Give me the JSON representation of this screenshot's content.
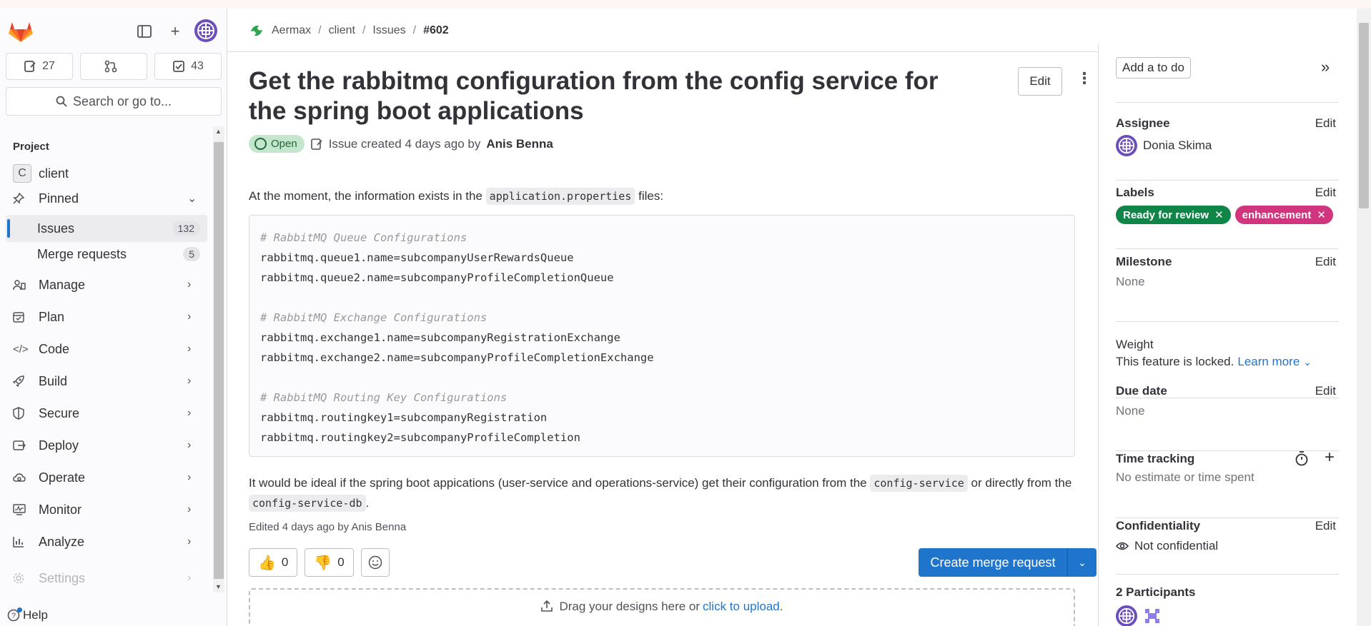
{
  "sidebar": {
    "counts": {
      "issues": "27",
      "merge_requests": "",
      "todos": "43"
    },
    "search_label": "Search or go to...",
    "section_title": "Project",
    "project": {
      "initial": "C",
      "name": "client"
    },
    "pinned_label": "Pinned",
    "pinned_items": [
      {
        "label": "Issues",
        "count": "132"
      },
      {
        "label": "Merge requests",
        "count": "5"
      }
    ],
    "nav": [
      "Manage",
      "Plan",
      "Code",
      "Build",
      "Secure",
      "Deploy",
      "Operate",
      "Monitor",
      "Analyze",
      "Settings"
    ],
    "help_label": "Help"
  },
  "breadcrumb": [
    "Aermax",
    "client",
    "Issues",
    "#602"
  ],
  "issue": {
    "title": "Get the rabbitmq configuration from the config service for the spring boot applications",
    "edit_label": "Edit",
    "status": "Open",
    "meta_prefix": "Issue created 4 days ago by",
    "author": "Anis Benna",
    "para1_before": "At the moment, the information exists in the",
    "para1_code": "application.properties",
    "para1_after": "files:",
    "code_lines": [
      {
        "text": "# RabbitMQ Queue Configurations",
        "comment": true
      },
      {
        "text": "rabbitmq.queue1.name=subcompanyUserRewardsQueue",
        "comment": false
      },
      {
        "text": "rabbitmq.queue2.name=subcompanyProfileCompletionQueue",
        "comment": false
      },
      {
        "text": "",
        "comment": false
      },
      {
        "text": "# RabbitMQ Exchange Configurations",
        "comment": true
      },
      {
        "text": "rabbitmq.exchange1.name=subcompanyRegistrationExchange",
        "comment": false
      },
      {
        "text": "rabbitmq.exchange2.name=subcompanyProfileCompletionExchange",
        "comment": false
      },
      {
        "text": "",
        "comment": false
      },
      {
        "text": "# RabbitMQ Routing Key Configurations",
        "comment": true
      },
      {
        "text": "rabbitmq.routingkey1=subcompanyRegistration",
        "comment": false
      },
      {
        "text": "rabbitmq.routingkey2=subcompanyProfileCompletion",
        "comment": false
      }
    ],
    "para2_before": "It would be ideal if the spring boot appications (user-service and operations-service) get their configuration from the",
    "para2_code1": "config-service",
    "para2_mid": "or directly from the",
    "para2_code2": "config-service-db",
    "para2_after": ".",
    "edited": "Edited 4 days ago by Anis Benna",
    "thumbs_up": "0",
    "thumbs_down": "0",
    "create_mr_label": "Create merge request",
    "drop_text": "Drag your designs here or",
    "drop_link": "click to upload",
    "drop_after": "."
  },
  "right": {
    "todo_label": "Add a to do",
    "edit_label": "Edit",
    "assignee_title": "Assignee",
    "assignee_name": "Donia Skima",
    "labels_title": "Labels",
    "labels": [
      {
        "name": "Ready for review",
        "color": "#108548"
      },
      {
        "name": "enhancement",
        "color": "#d1357e"
      }
    ],
    "milestone_title": "Milestone",
    "milestone_value": "None",
    "weight_title": "Weight",
    "weight_text": "This feature is locked.",
    "weight_link": "Learn more",
    "due_title": "Due date",
    "due_value": "None",
    "time_title": "Time tracking",
    "time_value": "No estimate or time spent",
    "conf_title": "Confidentiality",
    "conf_value": "Not confidential",
    "participants_title": "2 Participants"
  },
  "colors": {
    "accent": "#1f75cb",
    "open_bg": "#c3e6cd",
    "open_fg": "#24663b"
  }
}
